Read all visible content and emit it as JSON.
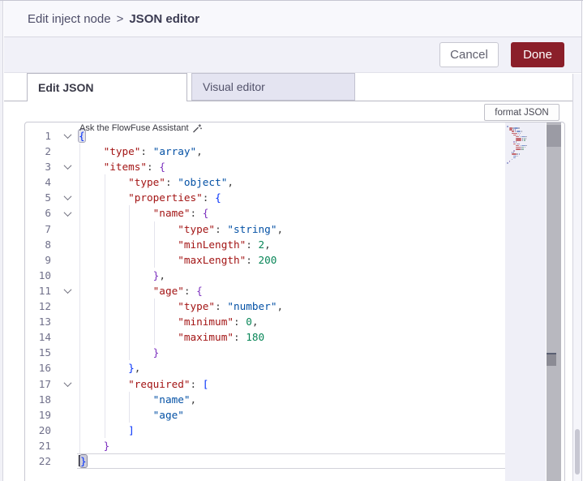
{
  "breadcrumb": {
    "parent": "Edit inject node",
    "separator": ">",
    "current": "JSON editor"
  },
  "header_actions": {
    "cancel": "Cancel",
    "done": "Done"
  },
  "tabs": {
    "edit_json": "Edit JSON",
    "visual_editor": "Visual editor"
  },
  "toolbar": {
    "format_json": "format JSON"
  },
  "editor": {
    "assistant_hint": "Ask the FlowFuse Assistant",
    "language": "json",
    "line_count": 22,
    "lines": [
      {
        "n": 1,
        "indent": 0,
        "fold": true,
        "segments": [
          {
            "t": "{",
            "c": "b1",
            "match": true
          }
        ]
      },
      {
        "n": 2,
        "indent": 1,
        "segments": [
          {
            "t": "    ",
            "c": "ws"
          },
          {
            "t": "\"type\"",
            "c": "key"
          },
          {
            "t": ": ",
            "c": "pun"
          },
          {
            "t": "\"array\"",
            "c": "str"
          },
          {
            "t": ",",
            "c": "pun"
          }
        ]
      },
      {
        "n": 3,
        "indent": 1,
        "fold": true,
        "segments": [
          {
            "t": "    ",
            "c": "ws"
          },
          {
            "t": "\"items\"",
            "c": "key"
          },
          {
            "t": ": ",
            "c": "pun"
          },
          {
            "t": "{",
            "c": "b2"
          }
        ]
      },
      {
        "n": 4,
        "indent": 2,
        "segments": [
          {
            "t": "        ",
            "c": "ws"
          },
          {
            "t": "\"type\"",
            "c": "key"
          },
          {
            "t": ": ",
            "c": "pun"
          },
          {
            "t": "\"object\"",
            "c": "str"
          },
          {
            "t": ",",
            "c": "pun"
          }
        ]
      },
      {
        "n": 5,
        "indent": 2,
        "fold": true,
        "segments": [
          {
            "t": "        ",
            "c": "ws"
          },
          {
            "t": "\"properties\"",
            "c": "key"
          },
          {
            "t": ": ",
            "c": "pun"
          },
          {
            "t": "{",
            "c": "b1"
          }
        ]
      },
      {
        "n": 6,
        "indent": 3,
        "fold": true,
        "segments": [
          {
            "t": "            ",
            "c": "ws"
          },
          {
            "t": "\"name\"",
            "c": "key"
          },
          {
            "t": ": ",
            "c": "pun"
          },
          {
            "t": "{",
            "c": "b2"
          }
        ]
      },
      {
        "n": 7,
        "indent": 4,
        "segments": [
          {
            "t": "                ",
            "c": "ws"
          },
          {
            "t": "\"type\"",
            "c": "key"
          },
          {
            "t": ": ",
            "c": "pun"
          },
          {
            "t": "\"string\"",
            "c": "str"
          },
          {
            "t": ",",
            "c": "pun"
          }
        ]
      },
      {
        "n": 8,
        "indent": 4,
        "segments": [
          {
            "t": "                ",
            "c": "ws"
          },
          {
            "t": "\"minLength\"",
            "c": "key"
          },
          {
            "t": ": ",
            "c": "pun"
          },
          {
            "t": "2",
            "c": "num"
          },
          {
            "t": ",",
            "c": "pun"
          }
        ]
      },
      {
        "n": 9,
        "indent": 4,
        "segments": [
          {
            "t": "                ",
            "c": "ws"
          },
          {
            "t": "\"maxLength\"",
            "c": "key"
          },
          {
            "t": ": ",
            "c": "pun"
          },
          {
            "t": "200",
            "c": "num"
          }
        ]
      },
      {
        "n": 10,
        "indent": 3,
        "segments": [
          {
            "t": "            ",
            "c": "ws"
          },
          {
            "t": "}",
            "c": "b2"
          },
          {
            "t": ",",
            "c": "pun"
          }
        ]
      },
      {
        "n": 11,
        "indent": 3,
        "fold": true,
        "segments": [
          {
            "t": "            ",
            "c": "ws"
          },
          {
            "t": "\"age\"",
            "c": "key"
          },
          {
            "t": ": ",
            "c": "pun"
          },
          {
            "t": "{",
            "c": "b2"
          }
        ]
      },
      {
        "n": 12,
        "indent": 4,
        "segments": [
          {
            "t": "                ",
            "c": "ws"
          },
          {
            "t": "\"type\"",
            "c": "key"
          },
          {
            "t": ": ",
            "c": "pun"
          },
          {
            "t": "\"number\"",
            "c": "str"
          },
          {
            "t": ",",
            "c": "pun"
          }
        ]
      },
      {
        "n": 13,
        "indent": 4,
        "segments": [
          {
            "t": "                ",
            "c": "ws"
          },
          {
            "t": "\"minimum\"",
            "c": "key"
          },
          {
            "t": ": ",
            "c": "pun"
          },
          {
            "t": "0",
            "c": "num"
          },
          {
            "t": ",",
            "c": "pun"
          }
        ]
      },
      {
        "n": 14,
        "indent": 4,
        "segments": [
          {
            "t": "                ",
            "c": "ws"
          },
          {
            "t": "\"maximum\"",
            "c": "key"
          },
          {
            "t": ": ",
            "c": "pun"
          },
          {
            "t": "180",
            "c": "num"
          }
        ]
      },
      {
        "n": 15,
        "indent": 3,
        "segments": [
          {
            "t": "            ",
            "c": "ws"
          },
          {
            "t": "}",
            "c": "b2"
          }
        ]
      },
      {
        "n": 16,
        "indent": 2,
        "segments": [
          {
            "t": "        ",
            "c": "ws"
          },
          {
            "t": "}",
            "c": "b1"
          },
          {
            "t": ",",
            "c": "pun"
          }
        ]
      },
      {
        "n": 17,
        "indent": 2,
        "fold": true,
        "segments": [
          {
            "t": "        ",
            "c": "ws"
          },
          {
            "t": "\"required\"",
            "c": "key"
          },
          {
            "t": ": ",
            "c": "pun"
          },
          {
            "t": "[",
            "c": "b1"
          }
        ]
      },
      {
        "n": 18,
        "indent": 3,
        "segments": [
          {
            "t": "            ",
            "c": "ws"
          },
          {
            "t": "\"name\"",
            "c": "str"
          },
          {
            "t": ",",
            "c": "pun"
          }
        ]
      },
      {
        "n": 19,
        "indent": 3,
        "segments": [
          {
            "t": "            ",
            "c": "ws"
          },
          {
            "t": "\"age\"",
            "c": "str"
          }
        ]
      },
      {
        "n": 20,
        "indent": 2,
        "segments": [
          {
            "t": "        ",
            "c": "ws"
          },
          {
            "t": "]",
            "c": "b1"
          }
        ]
      },
      {
        "n": 21,
        "indent": 1,
        "segments": [
          {
            "t": "    ",
            "c": "ws"
          },
          {
            "t": "}",
            "c": "b2"
          }
        ]
      },
      {
        "n": 22,
        "indent": 0,
        "current": true,
        "cursor": true,
        "segments": [
          {
            "t": "}",
            "c": "b1",
            "match": true
          }
        ]
      }
    ]
  },
  "colors": {
    "done_button": "#8b1f2a",
    "json_key": "#a31515",
    "json_string": "#0451a5",
    "json_number": "#098658",
    "bracket_blue": "#0431fa",
    "bracket_purple": "#7b2fbe",
    "inactive_tab_bg": "#e4e4f1",
    "minimap_bg": "#efeff7"
  }
}
